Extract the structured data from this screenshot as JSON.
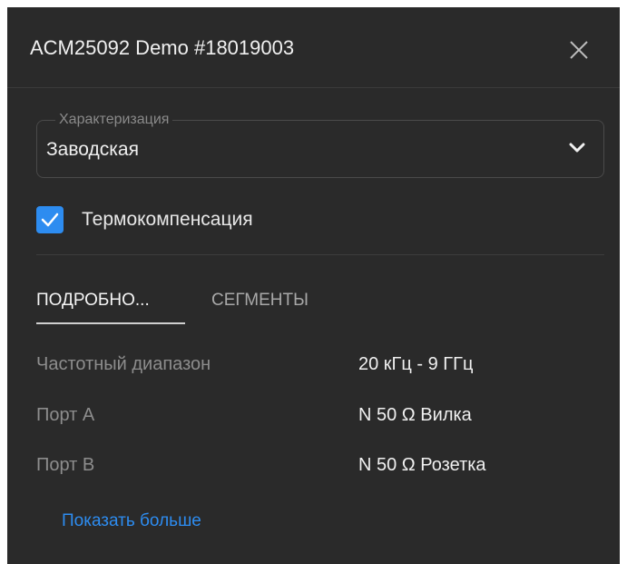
{
  "window": {
    "title": "ACM25092 Demo #18019003"
  },
  "characterization": {
    "label": "Характеризация",
    "value": "Заводская"
  },
  "thermo_compensation": {
    "label": "Термокомпенсация",
    "checked": true
  },
  "tabs": [
    {
      "label": "ПОДРОБНО...",
      "active": true
    },
    {
      "label": "СЕГМЕНТЫ",
      "active": false
    }
  ],
  "details": [
    {
      "label": "Частотный диапазон",
      "value": "20 кГц - 9 ГГц"
    },
    {
      "label": "Порт A",
      "value": "N 50 Ω Вилка"
    },
    {
      "label": "Порт B",
      "value": "N 50 Ω Розетка"
    }
  ],
  "show_more_label": "Показать больше",
  "colors": {
    "panel_bg": "#2a2a2a",
    "accent": "#2d8cf0"
  },
  "icons": {
    "close": "close-icon",
    "dropdown": "chevron-down-icon",
    "check": "checkmark-icon"
  }
}
